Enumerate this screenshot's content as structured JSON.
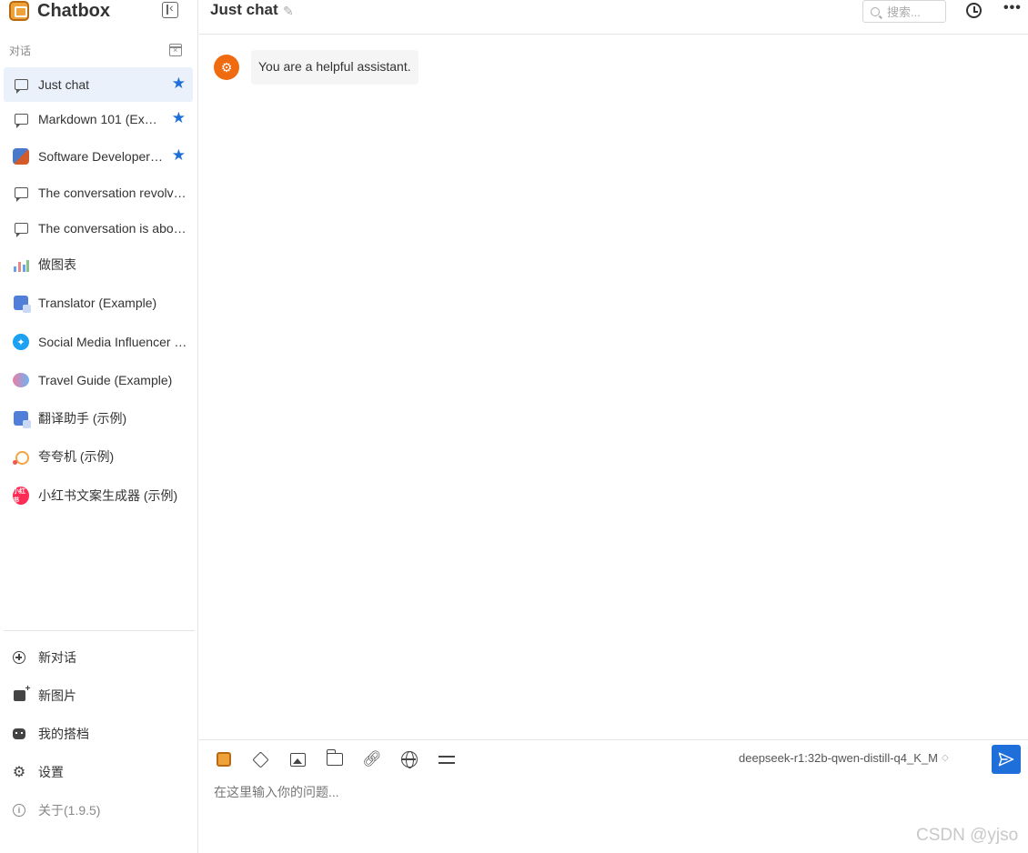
{
  "app": {
    "name": "Chatbox"
  },
  "sidebar": {
    "section_label": "对话",
    "sessions": [
      {
        "label": "Just chat",
        "icon": "chat-bubble-icon",
        "starred": true,
        "active": true
      },
      {
        "label": "Markdown 101 (Ex…",
        "icon": "chat-bubble-icon",
        "starred": true,
        "active": false
      },
      {
        "label": "Software Developer…",
        "icon": "developer-avatar-icon",
        "starred": true,
        "active": false
      },
      {
        "label": "The conversation revolve…",
        "icon": "chat-bubble-icon",
        "starred": false,
        "active": false
      },
      {
        "label": "The conversation is abo…",
        "icon": "chat-bubble-icon",
        "starred": false,
        "active": false
      },
      {
        "label": "做图表",
        "icon": "chart-avatar-icon",
        "starred": false,
        "active": false
      },
      {
        "label": "Translator (Example)",
        "icon": "translator-avatar-icon",
        "starred": false,
        "active": false
      },
      {
        "label": "Social Media Influencer (…",
        "icon": "twitter-avatar-icon",
        "starred": false,
        "active": false
      },
      {
        "label": "Travel Guide (Example)",
        "icon": "travel-avatar-icon",
        "starred": false,
        "active": false
      },
      {
        "label": "翻译助手 (示例)",
        "icon": "translator-avatar-icon",
        "starred": false,
        "active": false
      },
      {
        "label": "夸夸机 (示例)",
        "icon": "praise-avatar-icon",
        "starred": false,
        "active": false
      },
      {
        "label": "小红书文案生成器 (示例)",
        "icon": "xiaohongshu-avatar-icon",
        "starred": false,
        "active": false
      }
    ],
    "xhs_badge_text": "小红书",
    "bottom_menu": {
      "new_chat": "新对话",
      "new_image": "新图片",
      "my_copilots": "我的搭档",
      "settings": "设置",
      "about": "关于(1.9.5)"
    }
  },
  "header": {
    "title": "Just chat",
    "search_placeholder": "搜索...",
    "more_glyph": "•••"
  },
  "messages": [
    {
      "role": "system",
      "text": "You are a helpful assistant."
    }
  ],
  "composer": {
    "model": "deepseek-r1:32b-qwen-distill-q4_K_M",
    "placeholder": "在这里输入你的问题..."
  },
  "watermark": "CSDN @yjso",
  "colors": {
    "accent": "#1e6fd9",
    "system_avatar": "#f06a0f",
    "active_row": "#eaf1fb"
  }
}
